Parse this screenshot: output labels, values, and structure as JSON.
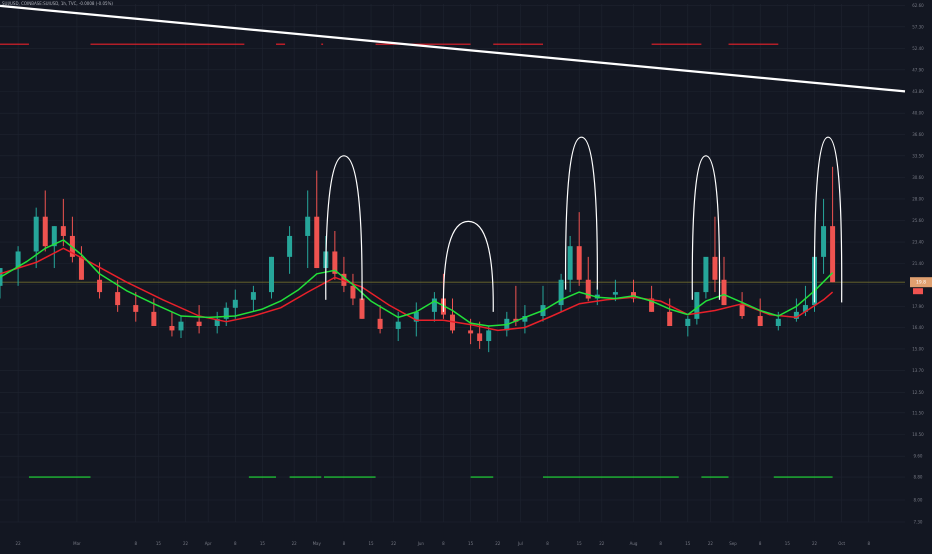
{
  "symbol_title": "SUI/USD, COINBASE:SUIUSD, 1h, TVC, -0.0008 (-0.05%)",
  "colors": {
    "background": "#131722",
    "grid": "#1f2430",
    "axis_text": "#787b86",
    "candle_up": "#26a69a",
    "candle_down": "#ef5350",
    "ma_red": "#e8202a",
    "ma_green": "#22e03a",
    "trendline": "#ffffff",
    "arc": "#ffffff",
    "level_line": "#6d6a2c",
    "price_tag": "#e0a070",
    "price_tag_red": "#ef5350"
  },
  "chart_data": {
    "type": "line",
    "title": "",
    "xlabel": "",
    "ylabel": "",
    "y_scale": "log",
    "ylim": [
      7.3,
      63
    ],
    "y_ticks": [
      7.3,
      8.0,
      8.8,
      9.6,
      10.5,
      11.5,
      12.5,
      13.7,
      15.0,
      16.4,
      17.9,
      19.6,
      21.4,
      23.4,
      25.6,
      28.0,
      30.6,
      33.5,
      36.6,
      40.0,
      43.8,
      47.9,
      52.4,
      57.3,
      62.6
    ],
    "y_tick_labels": [
      "7.30",
      "8.00",
      "8.80",
      "9.60",
      "10.50",
      "11.50",
      "12.50",
      "13.70",
      "15.00",
      "16.40",
      "17.90",
      "19.60",
      "21.40",
      "23.40",
      "25.60",
      "28.00",
      "30.60",
      "33.50",
      "36.60",
      "40.00",
      "43.80",
      "47.90",
      "52.40",
      "57.30",
      "62.60"
    ],
    "x_range": [
      0,
      100
    ],
    "x_ticks": [
      2,
      8.5,
      15,
      17.5,
      20.5,
      23,
      26,
      29,
      32.5,
      35,
      38,
      41,
      43.5,
      46.5,
      49,
      52,
      55,
      57.5,
      60.5,
      64,
      66.5,
      70,
      73,
      76,
      78.5,
      81,
      84,
      87,
      90,
      93,
      96
    ],
    "x_tick_labels": [
      "22",
      "Mar",
      "8",
      "15",
      "22",
      "Apr",
      "8",
      "15",
      "22",
      "May",
      "8",
      "15",
      "22",
      "Jun",
      "8",
      "15",
      "22",
      "Jul",
      "8",
      "15",
      "22",
      "Aug",
      "8",
      "15",
      "22",
      "Sep",
      "8",
      "15",
      "22",
      "Oct",
      "8"
    ],
    "current_price_label": "19.8",
    "level_value": 19.8,
    "series": [
      {
        "style": "candles",
        "x": [
          0,
          2,
          4,
          5,
          6,
          7,
          8,
          9,
          11,
          13,
          15,
          17,
          19,
          20,
          22,
          24,
          25,
          26,
          28,
          30,
          32,
          34,
          35,
          36,
          37,
          38,
          39,
          40,
          42,
          44,
          46,
          48,
          49,
          50,
          52,
          53,
          54,
          56,
          57,
          58,
          60,
          62,
          63,
          64,
          65,
          66,
          68,
          70,
          72,
          74,
          76,
          77,
          78,
          79,
          80,
          82,
          84,
          86,
          88,
          89,
          90,
          91,
          92
        ],
        "open": [
          19.5,
          21,
          22.5,
          26,
          23,
          25,
          24,
          22,
          20,
          19,
          18,
          17.5,
          16.5,
          16.2,
          16.8,
          16.5,
          17,
          17.8,
          18.4,
          19,
          22,
          24,
          26,
          21,
          22.5,
          20.5,
          19.5,
          18.5,
          17,
          16.3,
          16.8,
          17.5,
          18.5,
          17.3,
          16.2,
          16,
          15.5,
          16.2,
          17,
          16.8,
          17.2,
          18,
          20,
          23,
          20,
          18.5,
          18.8,
          19,
          18.5,
          17.5,
          16.5,
          17,
          19,
          22,
          20,
          18,
          17.2,
          16.5,
          17,
          17.5,
          18,
          22,
          25
        ],
        "high": [
          21,
          23,
          27,
          29,
          25,
          28,
          26,
          23,
          21.5,
          20,
          19,
          18.5,
          17.5,
          17.2,
          18,
          17.5,
          18.2,
          19.2,
          19.5,
          22,
          25,
          29,
          31.5,
          24,
          24.5,
          22,
          20.5,
          19.5,
          18,
          17.5,
          18.2,
          19,
          20.5,
          18.5,
          17,
          16.8,
          16.5,
          17.5,
          19.5,
          18,
          19.5,
          20.5,
          24,
          26.5,
          22,
          19.5,
          20,
          20,
          19.5,
          18.5,
          17.2,
          19,
          21.5,
          26,
          22,
          19,
          18.5,
          17.5,
          18.5,
          19.5,
          23,
          28,
          32
        ],
        "low": [
          18.5,
          19.5,
          21,
          22.5,
          21,
          23,
          21.5,
          20,
          18.5,
          17.5,
          16.8,
          16.5,
          15.8,
          15.7,
          16,
          16,
          16.5,
          17,
          17.5,
          18.5,
          20.5,
          21,
          22,
          20,
          20,
          19,
          18,
          17,
          16,
          15.5,
          15.8,
          16.8,
          17,
          16,
          15.3,
          15,
          14.8,
          15.8,
          16.5,
          16,
          16.8,
          17.5,
          19,
          19.5,
          18.3,
          18,
          18.3,
          18.2,
          17.5,
          16.5,
          15.8,
          16.6,
          18.5,
          19,
          18,
          17,
          16.5,
          16.2,
          16.8,
          17.2,
          17.5,
          20.5,
          19.8
        ],
        "close": [
          21,
          22.5,
          26,
          23,
          25,
          24,
          22,
          20,
          19,
          18,
          17.5,
          16.5,
          16.2,
          16.8,
          16.5,
          17,
          17.8,
          18.4,
          19,
          22,
          24,
          26,
          21,
          22.5,
          20.5,
          19.5,
          18.5,
          17,
          16.3,
          16.8,
          17.5,
          18.5,
          17.3,
          16.2,
          16,
          15.5,
          16.2,
          17,
          16.8,
          17.2,
          18,
          20,
          23,
          20,
          18.5,
          18.8,
          19,
          18.5,
          17.5,
          16.5,
          17,
          19,
          22,
          20,
          18,
          17.2,
          16.5,
          17,
          17.5,
          18,
          22,
          25,
          19.8
        ]
      },
      {
        "style": "line",
        "color": "#e8202a",
        "x": [
          0,
          4,
          7,
          10,
          14,
          18,
          22,
          25,
          28,
          31,
          34,
          37,
          40,
          43,
          46,
          49,
          52,
          55,
          58,
          61,
          64,
          67,
          70,
          73,
          76,
          79,
          82,
          85,
          88,
          91,
          92
        ],
        "y": [
          20.5,
          21.5,
          22.8,
          21.5,
          19.8,
          18.4,
          17.2,
          16.8,
          17.2,
          17.8,
          19,
          20.2,
          19.4,
          18,
          16.9,
          16.9,
          16.6,
          16.2,
          16.4,
          17.2,
          18.1,
          18.4,
          18.6,
          18.3,
          17.3,
          17.6,
          18.1,
          17.3,
          17.1,
          18.4,
          19
        ]
      },
      {
        "style": "line",
        "color": "#22e03a",
        "x": [
          0,
          3,
          5,
          7,
          9,
          11,
          14,
          17,
          20,
          23,
          26,
          29,
          31,
          33,
          35,
          37,
          39,
          41,
          44,
          46,
          48,
          50,
          52,
          54,
          56,
          58,
          60,
          62,
          64,
          66,
          68,
          70,
          72,
          74,
          76,
          78,
          80,
          82,
          84,
          86,
          88,
          90,
          92
        ],
        "y": [
          20.2,
          21.6,
          22.8,
          23.6,
          22.2,
          20.5,
          19.1,
          18.1,
          17.2,
          17.1,
          17.2,
          17.7,
          18.3,
          19.2,
          20.5,
          20.8,
          19.6,
          18.3,
          17.1,
          17.5,
          18.3,
          17.6,
          16.7,
          16.5,
          16.6,
          17.1,
          17.6,
          18.4,
          19,
          18.6,
          18.5,
          18.7,
          18.3,
          17.7,
          17.3,
          18.3,
          18.8,
          18.2,
          17.6,
          17.2,
          17.9,
          19.1,
          20.6
        ]
      },
      {
        "style": "line",
        "color": "#ffffff",
        "x": [
          0,
          100
        ],
        "y": [
          62.5,
          43.8
        ]
      }
    ],
    "arcs": [
      {
        "x": [
          36,
          40
        ],
        "base": 18.4,
        "peak": 33.5
      },
      {
        "x": [
          49,
          54.5
        ],
        "base": 17.5,
        "peak": 25.5
      },
      {
        "x": [
          62.5,
          66
        ],
        "base": 19.2,
        "peak": 36.2
      },
      {
        "x": [
          76.5,
          79.5
        ],
        "base": 18.4,
        "peak": 33.5
      },
      {
        "x": [
          90,
          93
        ],
        "base": 18.2,
        "peak": 36.2
      }
    ],
    "red_segments": [
      [
        0,
        3.2
      ],
      [
        10,
        27
      ],
      [
        30.5,
        31.5
      ],
      [
        35.5,
        35.7
      ],
      [
        41.5,
        52
      ],
      [
        54.5,
        60
      ],
      [
        72,
        77.5
      ],
      [
        80.5,
        86
      ]
    ],
    "red_segments_y": 53.3,
    "green_segments": [
      [
        3.2,
        10
      ],
      [
        27.5,
        30.5
      ],
      [
        32,
        35.5
      ],
      [
        35.8,
        41.5
      ],
      [
        52,
        54.5
      ],
      [
        60,
        70
      ],
      [
        70,
        75
      ],
      [
        77.5,
        80.5
      ],
      [
        85.5,
        92
      ]
    ],
    "green_segments_y": 8.8
  }
}
